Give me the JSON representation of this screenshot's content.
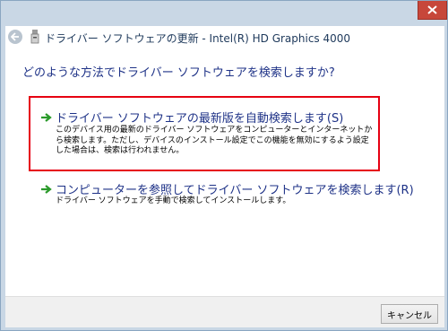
{
  "window": {
    "close_button": "close"
  },
  "nav": {
    "back_icon": "back-arrow-icon",
    "device_icon": "usb-device-icon",
    "title": "ドライバー ソフトウェアの更新 - Intel(R) HD Graphics 4000"
  },
  "main": {
    "question": "どのような方法でドライバー ソフトウェアを検索しますか?",
    "options": [
      {
        "icon": "green-arrow-icon",
        "title": "ドライバー ソフトウェアの最新版を自動検索します(S)",
        "description": "このデバイス用の最新のドライバー ソフトウェアをコンピューターとインターネットから検索します。ただし、デバイスのインストール設定でこの機能を無効にするよう設定した場合は、検索は行われません。"
      },
      {
        "icon": "green-arrow-icon",
        "title": "コンピューターを参照してドライバー ソフトウェアを検索します(R)",
        "description": "ドライバー ソフトウェアを手動で検索してインストールします。"
      }
    ]
  },
  "footer": {
    "cancel_label": "キャンセル"
  },
  "colors": {
    "accent_link": "#1e3287",
    "highlight_border": "#e60012",
    "close_red": "#c7473a",
    "frame": "#c9d7e5"
  }
}
